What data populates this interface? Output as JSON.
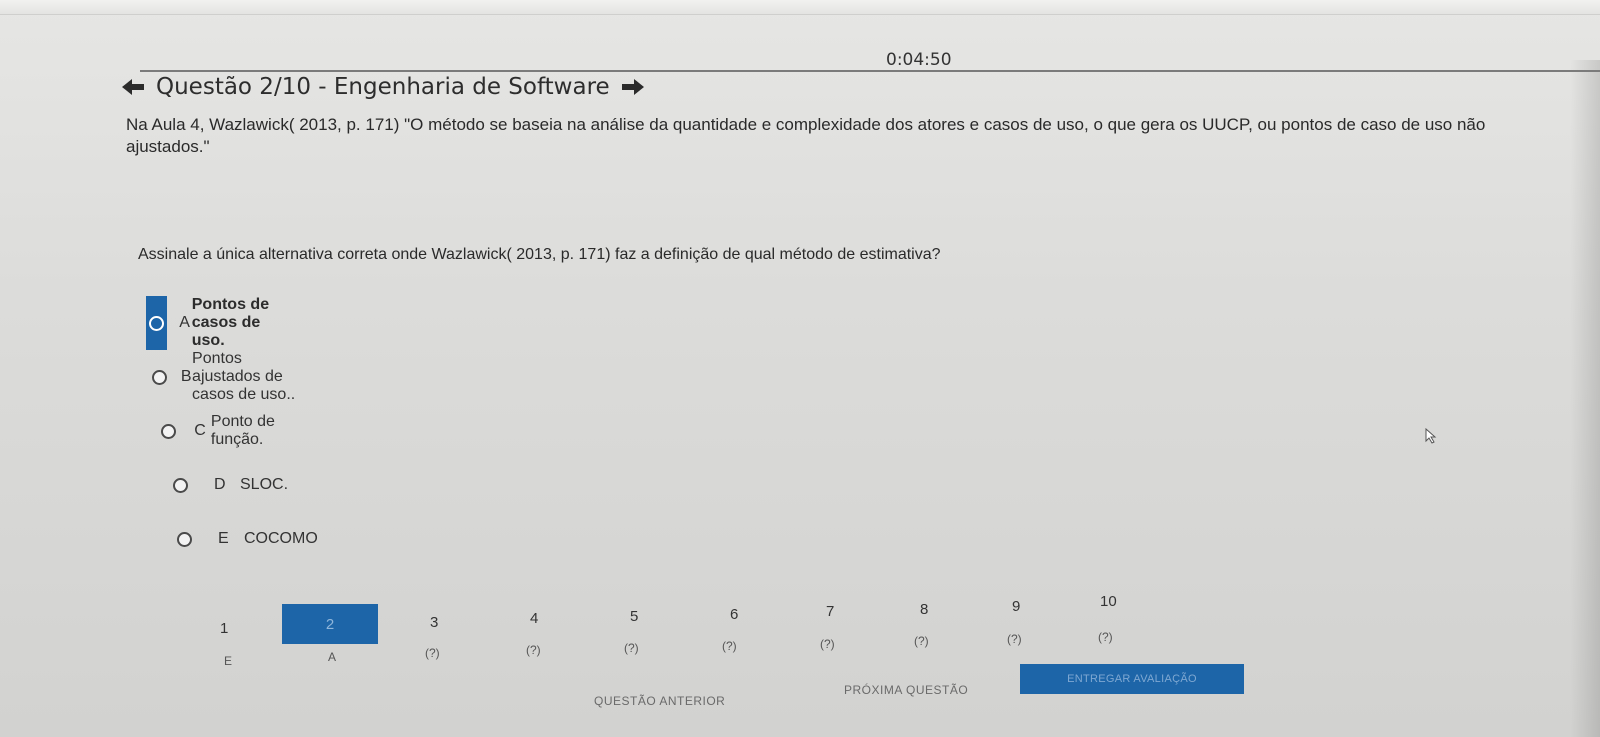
{
  "timer": "0:04:50",
  "question": {
    "title": "Questão 2/10 - Engenharia de Software",
    "statement_line1": "Na Aula 4, Wazlawick( 2013, p. 171) \"O método se baseia na análise da quantidade e complexidade dos atores e casos de uso, o que gera os UUCP, ou pontos de caso de uso não",
    "statement_line2": "ajustados.\"",
    "prompt": "Assinale a única alternativa correta onde Wazlawick( 2013, p. 171) faz a definição de qual método de estimativa?"
  },
  "options": [
    {
      "letter": "A",
      "text": "Pontos de casos de uso.",
      "selected": true
    },
    {
      "letter": "B",
      "text": "Pontos ajustados de casos de uso..",
      "selected": false
    },
    {
      "letter": "C",
      "text": "Ponto de função.",
      "selected": false
    },
    {
      "letter": "D",
      "text": "SLOC.",
      "selected": false
    },
    {
      "letter": "E",
      "text": "COCOMO",
      "selected": false
    }
  ],
  "navigation": {
    "numbers": [
      "1",
      "2",
      "3",
      "4",
      "5",
      "6",
      "7",
      "8",
      "9",
      "10"
    ],
    "answers": [
      "E",
      "A",
      "(?)",
      "(?)",
      "(?)",
      "(?)",
      "(?)",
      "(?)",
      "(?)",
      "(?)"
    ],
    "current": "2"
  },
  "footer": {
    "previous": "QUESTÃO ANTERIOR",
    "next": "PRÓXIMA QUESTÃO",
    "submit": "ENTREGAR AVALIAÇÃO"
  },
  "icons": {
    "back": "arrow-left-icon",
    "forward": "arrow-right-icon"
  },
  "colors": {
    "accent": "#1d65a8"
  }
}
